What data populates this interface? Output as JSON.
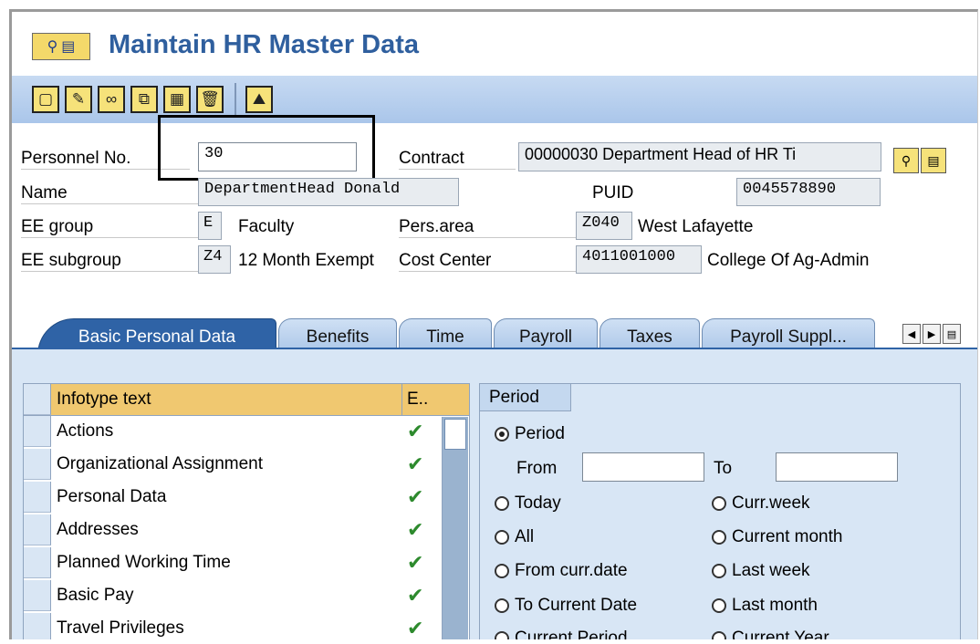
{
  "window": {
    "title": "Maintain HR Master Data"
  },
  "header": {
    "personnel_label": "Personnel No.",
    "personnel_value": "30",
    "contract_label": "Contract",
    "contract_value": "00000030 Department Head of HR Ti",
    "name_label": "Name",
    "name_value": "DepartmentHead Donald",
    "puid_label": "PUID",
    "puid_value": "0045578890",
    "ee_group_label": "EE group",
    "ee_group_code": "E",
    "ee_group_text": "Faculty",
    "pers_area_label": "Pers.area",
    "pers_area_code": "Z040",
    "pers_area_text": "West Lafayette",
    "ee_subgroup_label": "EE subgroup",
    "ee_subgroup_code": "Z4",
    "ee_subgroup_text": "12 Month Exempt",
    "cost_center_label": "Cost Center",
    "cost_center_code": "4011001000",
    "cost_center_text": "College Of Ag-Admin"
  },
  "tabs": [
    {
      "label": "Basic Personal Data"
    },
    {
      "label": "Benefits"
    },
    {
      "label": "Time"
    },
    {
      "label": "Payroll"
    },
    {
      "label": "Taxes"
    },
    {
      "label": "Payroll Suppl..."
    }
  ],
  "infotypes": {
    "col_text": "Infotype text",
    "col_e": "E..",
    "rows": [
      {
        "text": "Actions"
      },
      {
        "text": "Organizational Assignment"
      },
      {
        "text": "Personal Data"
      },
      {
        "text": "Addresses"
      },
      {
        "text": "Planned Working Time"
      },
      {
        "text": "Basic Pay"
      },
      {
        "text": "Travel Privileges"
      }
    ]
  },
  "period": {
    "title": "Period",
    "period_radio": "Period",
    "from_label": "From",
    "to_label": "To",
    "options": {
      "today": "Today",
      "curr_week": "Curr.week",
      "all": "All",
      "current_month": "Current month",
      "from_curr_date": "From curr.date",
      "last_week": "Last week",
      "to_current_date": "To Current Date",
      "last_month": "Last month",
      "current_period": "Current Period",
      "current_year": "Current Year"
    }
  },
  "icons": {
    "title": [
      "tree-icon",
      "list-icon"
    ],
    "toolbar": [
      "create-icon",
      "change-icon",
      "display-icon",
      "copy-icon",
      "delimit-icon",
      "delete-icon",
      "overview-icon"
    ]
  }
}
